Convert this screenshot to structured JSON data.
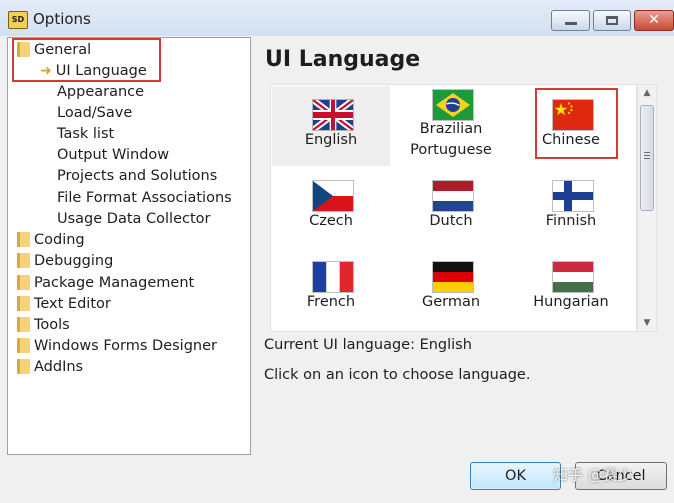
{
  "window": {
    "title": "Options",
    "icon": "app-icon",
    "app_icon_text": "SD"
  },
  "tree": {
    "items": [
      {
        "label": "General",
        "icon": "folder-icon"
      },
      {
        "label": "UI Language",
        "icon": "arrow-right-icon",
        "selected": true
      },
      {
        "label": "Appearance"
      },
      {
        "label": "Load/Save"
      },
      {
        "label": "Task list"
      },
      {
        "label": "Output Window"
      },
      {
        "label": "Projects and Solutions"
      },
      {
        "label": "File Format Associations"
      },
      {
        "label": "Usage Data Collector"
      },
      {
        "label": "Coding",
        "icon": "folder-icon"
      },
      {
        "label": "Debugging",
        "icon": "folder-icon"
      },
      {
        "label": "Package Management",
        "icon": "folder-icon"
      },
      {
        "label": "Text Editor",
        "icon": "folder-icon"
      },
      {
        "label": "Tools",
        "icon": "folder-icon"
      },
      {
        "label": "Windows Forms Designer",
        "icon": "folder-icon"
      },
      {
        "label": "AddIns",
        "icon": "folder-icon"
      }
    ]
  },
  "panel": {
    "heading": "UI Language",
    "languages": [
      {
        "label": "English",
        "flag": "uk-flag-icon",
        "selected": true
      },
      {
        "label": "Brazilian\nPortuguese",
        "flag": "brazil-flag-icon"
      },
      {
        "label": "Chinese",
        "flag": "china-flag-icon",
        "highlighted": true
      },
      {
        "label": "Czech",
        "flag": "czech-flag-icon"
      },
      {
        "label": "Dutch",
        "flag": "netherlands-flag-icon"
      },
      {
        "label": "Finnish",
        "flag": "finland-flag-icon"
      },
      {
        "label": "French",
        "flag": "france-flag-icon"
      },
      {
        "label": "German",
        "flag": "germany-flag-icon"
      },
      {
        "label": "Hungarian",
        "flag": "hungary-flag-icon"
      }
    ],
    "current_language_text": "Current UI language: English",
    "hint_text": "Click on an icon to choose language."
  },
  "buttons": {
    "ok": "OK",
    "cancel": "Cancel"
  },
  "watermark": "知乎 @赛少",
  "colors": {
    "highlight_border": "#d43a3a",
    "selection_bg": "#eeeeee",
    "default_button_border": "#3c7fb1"
  }
}
